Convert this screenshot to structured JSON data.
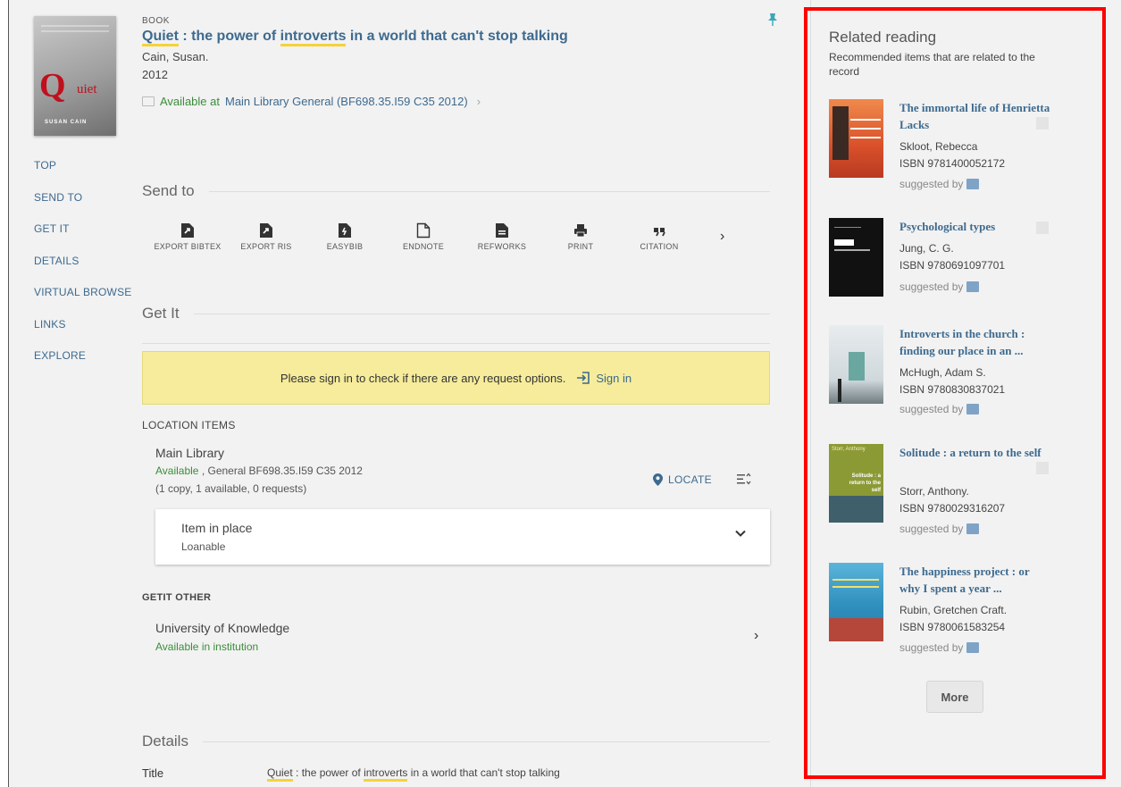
{
  "record": {
    "type": "BOOK",
    "title_hl1": "Quiet",
    "title_part2": " : the power of ",
    "title_hl2": "introverts",
    "title_part3": " in a world that can't stop talking",
    "author": "Cain, Susan.",
    "year": "2012",
    "availability_status": "Available at",
    "availability_location": "Main Library  General (BF698.35.I59 C35 2012)",
    "cover_author": "SUSAN CAIN",
    "cover_q": "Q",
    "cover_uiet": "uiet"
  },
  "left_nav": [
    "TOP",
    "SEND TO",
    "GET IT",
    "DETAILS",
    "VIRTUAL BROWSE",
    "LINKS",
    "EXPLORE"
  ],
  "send_to": {
    "heading": "Send to",
    "items": [
      {
        "label": "EXPORT BIBTEX",
        "icon": "export-bibtex-icon"
      },
      {
        "label": "EXPORT RIS",
        "icon": "export-ris-icon"
      },
      {
        "label": "EASYBIB",
        "icon": "easybib-icon"
      },
      {
        "label": "ENDNOTE",
        "icon": "endnote-icon"
      },
      {
        "label": "REFWORKS",
        "icon": "refworks-icon"
      },
      {
        "label": "PRINT",
        "icon": "print-icon"
      },
      {
        "label": "CITATION",
        "icon": "citation-icon"
      }
    ]
  },
  "get_it": {
    "heading": "Get It",
    "signin_message": "Please sign in to check if there are any request options.",
    "signin_link": "Sign in",
    "location_items_label": "LOCATION ITEMS",
    "library": "Main Library",
    "status_available": "Available",
    "status_rest": " , General BF698.35.I59 C35 2012",
    "counts": "(1 copy, 1 available, 0 requests)",
    "locate_label": "LOCATE",
    "item_status": "Item in place",
    "item_policy": "Loanable",
    "getit_other_label": "GETIT OTHER",
    "other_institution": "University of Knowledge",
    "other_availability": "Available in institution"
  },
  "details": {
    "heading": "Details",
    "title_label": "Title",
    "title_hl1": "Quiet",
    "title_part2": " : the power of ",
    "title_hl2": "introverts",
    "title_part3": " in a world that can't stop talking"
  },
  "related": {
    "heading": "Related reading",
    "subheading": "Recommended items that are related to the record",
    "suggested_label": "suggested by",
    "more_label": "More",
    "items": [
      {
        "title": "The immortal life of Henrietta Lacks",
        "author": "Skloot, Rebecca",
        "isbn": "ISBN 9781400052172",
        "cover_color": "#e0653a"
      },
      {
        "title": "Psychological types",
        "author": "Jung, C. G.",
        "isbn": "ISBN 9780691097701",
        "cover_color": "#111111"
      },
      {
        "title": "Introverts in the church : finding our place in an ...",
        "author": "McHugh, Adam S.",
        "isbn": "ISBN 9780830837021",
        "cover_color": "#dde3e6"
      },
      {
        "title": "Solitude : a return to the self",
        "author": "Storr, Anthony.",
        "isbn": "ISBN 9780029316207",
        "cover_color": "#8c9a35",
        "cover_text_top": "Storr, Anthony",
        "cover_text_mid": "Solitude : a return to the self"
      },
      {
        "title": "The happiness project : or why I spent a year   ...",
        "author": "Rubin, Gretchen Craft.",
        "isbn": "ISBN 9780061583254",
        "cover_color": "#3c9bc4"
      }
    ]
  },
  "colors": {
    "link": "#3d6a8f",
    "available": "#3a8d3a",
    "highlight": "#f6d23c",
    "signin_bg": "#f6ec9b",
    "annotation_border": "#ff0000"
  }
}
